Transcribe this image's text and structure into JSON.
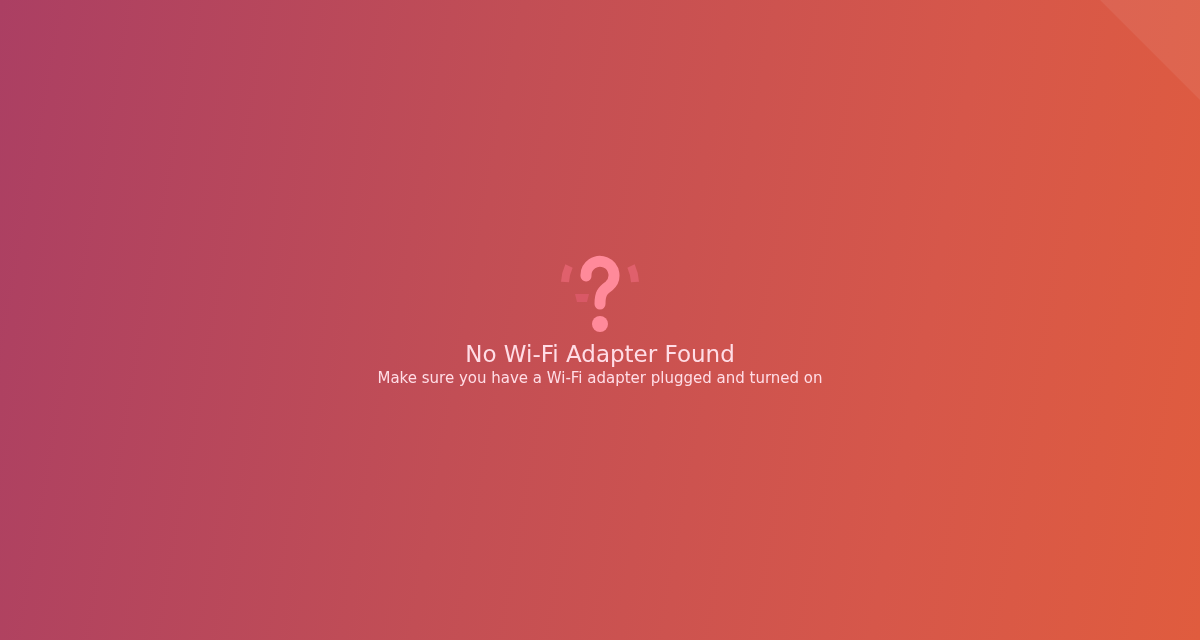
{
  "status": {
    "title": "No Wi-Fi Adapter Found",
    "message": "Make sure you have a Wi-Fi adapter plugged and turned on"
  }
}
